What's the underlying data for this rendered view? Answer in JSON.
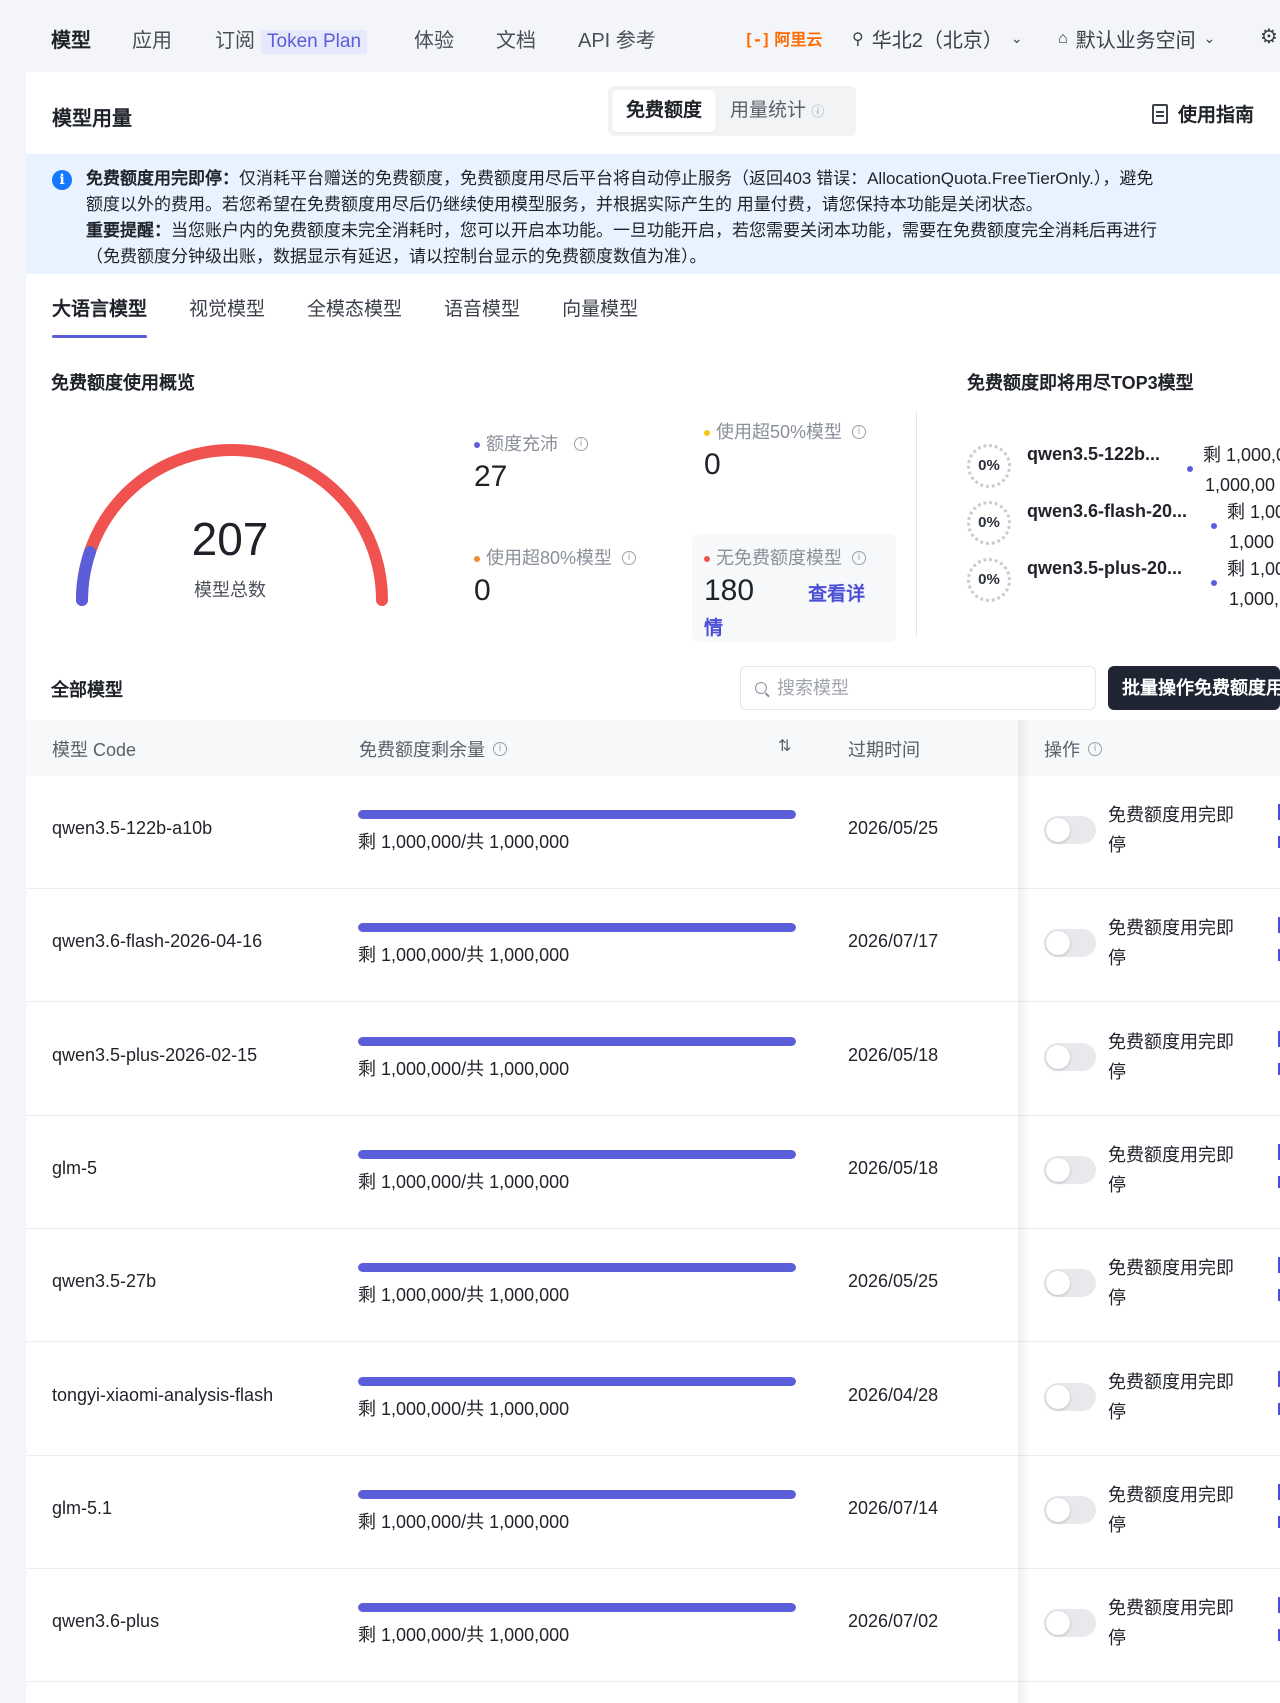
{
  "nav": {
    "items": [
      "模型",
      "应用",
      "订阅",
      "体验",
      "文档",
      "API 参考"
    ],
    "token_badge": "Token Plan",
    "logo": "阿里云",
    "region": "华北2（北京）",
    "workspace": "默认业务空间"
  },
  "header": {
    "title": "模型用量",
    "seg_free": "免费额度",
    "seg_stats": "用量统计",
    "guide": "使用指南"
  },
  "banner": {
    "line1_bold": "免费额度用完即停：",
    "line1": "仅消耗平台赠送的免费额度，免费额度用尽后平台将自动停止服务（返回403 错误：AllocationQuota.FreeTierOnly.），避免",
    "line2": "额度以外的费用。若您希望在免费额度用尽后仍继续使用模型服务，并根据实际产生的 用量付费，请您保持本功能是关闭状态。",
    "line3_bold": "重要提醒：",
    "line3": "当您账户内的免费额度未完全消耗时，您可以开启本功能。一旦功能开启，若您需要关闭本功能，需要在免费额度完全消耗后再进行",
    "line4": "（免费额度分钟级出账，数据显示有延迟，请以控制台显示的免费额度数值为准）。"
  },
  "tabs": [
    "大语言模型",
    "视觉模型",
    "全模态模型",
    "语音模型",
    "向量模型"
  ],
  "overview": {
    "title": "免费额度使用概览",
    "total_value": "207",
    "total_label": "模型总数",
    "stats": {
      "ample_label": "额度充沛",
      "ample_value": "27",
      "over50_label": "使用超50%模型",
      "over50_value": "0",
      "over80_label": "使用超80%模型",
      "over80_value": "0",
      "none_label": "无免费额度模型",
      "none_value": "180",
      "detail_link": "查看详情"
    },
    "colors": {
      "ample": "#5b5ed8",
      "over50": "#f5c518",
      "over80": "#f08c2e",
      "none": "#f0524f"
    }
  },
  "top3": {
    "title": "免费额度即将用尽TOP3模型",
    "items": [
      {
        "percent": "0%",
        "name": "qwen3.5-122b...",
        "remain_a": "剩 1,000,0",
        "remain_b": "1,000,00"
      },
      {
        "percent": "0%",
        "name": "qwen3.6-flash-20...",
        "remain_a": "剩 1,00",
        "remain_b": "1,000"
      },
      {
        "percent": "0%",
        "name": "qwen3.5-plus-20...",
        "remain_a": "剩 1,00",
        "remain_b": "1,000,"
      }
    ]
  },
  "all_models": {
    "title": "全部模型",
    "search_placeholder": "搜索模型",
    "batch_button": "批量操作免费额度用",
    "columns": {
      "code": "模型 Code",
      "remain": "免费额度剩余量",
      "expire": "过期时间",
      "op": "操作"
    },
    "toggle_label": "免费额度用完即停",
    "rows": [
      {
        "code": "qwen3.5-122b-a10b",
        "remain": "剩 1,000,000/共 1,000,000",
        "fill": 1.0,
        "expire": "2026/05/25"
      },
      {
        "code": "qwen3.6-flash-2026-04-16",
        "remain": "剩 1,000,000/共 1,000,000",
        "fill": 1.0,
        "expire": "2026/07/17"
      },
      {
        "code": "qwen3.5-plus-2026-02-15",
        "remain": "剩 1,000,000/共 1,000,000",
        "fill": 1.0,
        "expire": "2026/05/18"
      },
      {
        "code": "glm-5",
        "remain": "剩 1,000,000/共 1,000,000",
        "fill": 1.0,
        "expire": "2026/05/18"
      },
      {
        "code": "qwen3.5-27b",
        "remain": "剩 1,000,000/共 1,000,000",
        "fill": 1.0,
        "expire": "2026/05/25"
      },
      {
        "code": "tongyi-xiaomi-analysis-flash",
        "remain": "剩 1,000,000/共 1,000,000",
        "fill": 1.0,
        "expire": "2026/04/28"
      },
      {
        "code": "glm-5.1",
        "remain": "剩 1,000,000/共 1,000,000",
        "fill": 1.0,
        "expire": "2026/07/14"
      },
      {
        "code": "qwen3.6-plus",
        "remain": "剩 1,000,000/共 1,000,000",
        "fill": 1.0,
        "expire": "2026/07/02"
      }
    ]
  }
}
